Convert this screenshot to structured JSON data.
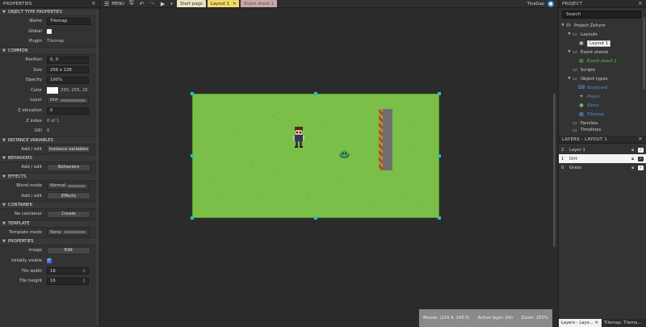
{
  "props_panel": {
    "title": "PROPERTIES",
    "sections": {
      "object_type": "OBJECT TYPE PROPERTIES",
      "common": "COMMON",
      "instance_vars": "INSTANCE VARIABLES",
      "behaviors": "BEHAVIORS",
      "effects": "EFFECTS",
      "container": "CONTAINER",
      "template": "TEMPLATE",
      "properties": "PROPERTIES"
    },
    "name_label": "Name",
    "name_value": "Tilemap",
    "global_label": "Global",
    "plugin_label": "Plugin",
    "plugin_value": "Tilemap",
    "position_label": "Position",
    "position_value": "0, 0",
    "size_label": "Size",
    "size_value": "256 x 128",
    "opacity_label": "Opacity",
    "opacity_value": "100%",
    "color_label": "Color",
    "color_value": "255, 255, 25",
    "layer_label": "Layer",
    "layer_value": "Dirt",
    "zelev_label": "Z elevation",
    "zelev_value": "0",
    "zindex_label": "Z index",
    "zindex_value": "0 of 1",
    "uid_label": "UID",
    "uid_value": "0",
    "addedit_label": "Add / edit",
    "instance_vars_btn": "Instance variables",
    "behaviors_btn": "Behaviors",
    "blend_label": "Blend mode",
    "blend_value": "Normal",
    "effects_btn": "Effects",
    "container_label": "No container",
    "container_btn": "Create",
    "template_label": "Template mode",
    "template_value": "None",
    "image_label": "Image",
    "image_btn": "Edit",
    "initially_visible_label": "Initially visible",
    "tile_width_label": "Tile width",
    "tile_width_value": "16",
    "tile_height_label": "Tile height",
    "tile_height_value": "16"
  },
  "toolbar": {
    "menu_label": "MENU",
    "tabs": [
      "Start page",
      "Layout 1",
      "Event sheet 1"
    ],
    "close_glyph": "✕",
    "user_name": "TinaGap"
  },
  "status_bar": {
    "mouse": "Mouse: (224.4, 143.5)",
    "active_layer": "Active layer: Dirt",
    "zoom": "Zoom: 255%"
  },
  "project_panel": {
    "title": "PROJECT",
    "search_placeholder": "Search",
    "root": "Project Zelrym",
    "layouts": "Layouts",
    "layout1": "Layout 1",
    "event_sheets": "Event sheets",
    "event_sheet1": "Event sheet 1",
    "scripts": "Scripts",
    "object_types": "Object types",
    "objects": [
      "Keyboard",
      "Player",
      "Slime",
      "Tilemap"
    ],
    "families": "Families",
    "timelines": "Timelines"
  },
  "layers_panel": {
    "title": "LAYERS - LAYOUT 1",
    "layers": [
      {
        "num": "2",
        "name": "Layer 1"
      },
      {
        "num": "1",
        "name": "Dirt"
      },
      {
        "num": "0",
        "name": "Grass"
      }
    ],
    "tab_active": "Layers - Layo...",
    "tab_inactive": "Tilemap: Tilema..."
  },
  "colors": {
    "layout_bg": "#7bbf49",
    "selection_handle": "#25c2c8",
    "active_tab": "#f1d86b",
    "event_text": "#4fcf4a",
    "object_text": "#4e8fd9"
  }
}
